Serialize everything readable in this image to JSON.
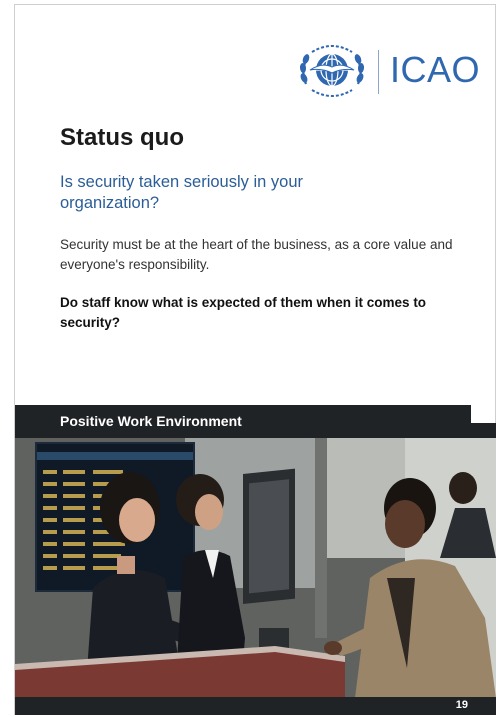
{
  "logo": {
    "wordmark": "ICAO",
    "emblem_icon": "icao-emblem-icon",
    "brand_color": "#2f67b0"
  },
  "title": "Status quo",
  "question": "Is security taken seriously in your organization?",
  "body": "Security must be at the heart of the business, as a core value and everyone's responsibility.",
  "bold_question": "Do staff know what is expected of them when it comes to security?",
  "section_banner": "Positive Work Environment",
  "photo": {
    "description_icon": "airport-check-in-photo"
  },
  "page_number": "19",
  "colors": {
    "heading_blue": "#2b5d97",
    "banner_dark": "#202326"
  }
}
